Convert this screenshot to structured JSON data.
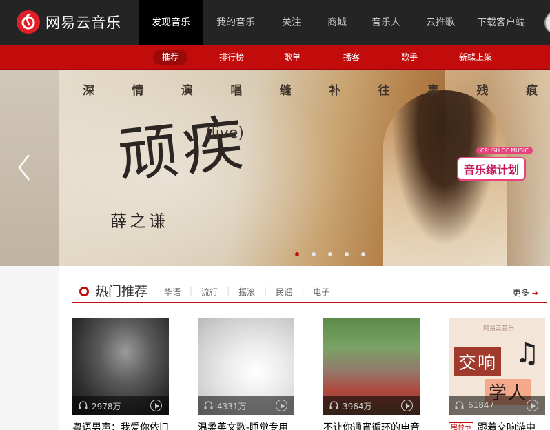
{
  "app": {
    "logo_text": "网易云音乐"
  },
  "topnav": {
    "items": [
      {
        "label": "发现音乐"
      },
      {
        "label": "我的音乐"
      },
      {
        "label": "关注"
      },
      {
        "label": "商城"
      },
      {
        "label": "音乐人"
      },
      {
        "label": "云推歌"
      },
      {
        "label": "下载客户端"
      }
    ],
    "active_index": 0
  },
  "subnav": {
    "items": [
      {
        "label": "推荐"
      },
      {
        "label": "排行榜"
      },
      {
        "label": "歌单"
      },
      {
        "label": "播客"
      },
      {
        "label": "歌手"
      },
      {
        "label": "新蝶上架"
      }
    ],
    "active_index": 0
  },
  "banner": {
    "lyric_line": [
      "深",
      "情",
      "演",
      "唱",
      "缝",
      "补",
      "往",
      "事",
      "残",
      "痕"
    ],
    "title": "顽疾",
    "live": "(live)",
    "artist": "薛之谦",
    "badge_tag": "CRUSH OF MUSIC",
    "badge_text": "音乐缘计划",
    "dots_count": 5,
    "active_dot": 0
  },
  "hot": {
    "title": "热门推荐",
    "tags": [
      "华语",
      "流行",
      "摇滚",
      "民谣",
      "电子"
    ],
    "more": "更多",
    "cards": [
      {
        "count": "2978万",
        "title": "粤语男声：我爱你依旧"
      },
      {
        "count": "4331万",
        "title": "温柔英文歌-睡觉专用"
      },
      {
        "count": "3964万",
        "title": "不让你通宵循环的电音"
      },
      {
        "count": "61847",
        "title": "跟着交响游中",
        "badge": "电台节",
        "cover_watermark": "网易云音乐",
        "cover_text_1": "交响",
        "cover_text_2": "学人",
        "cover_note": "♫"
      }
    ]
  },
  "colors": {
    "brand_red": "#c20c0c",
    "topbar": "#242424"
  }
}
